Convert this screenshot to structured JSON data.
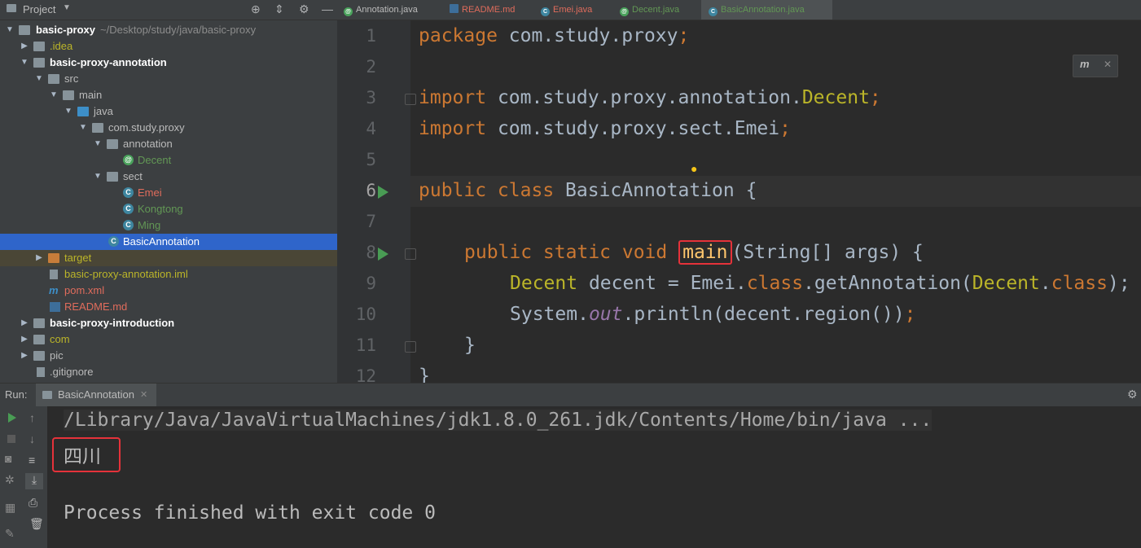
{
  "project_panel": {
    "title": "Project",
    "tree": [
      {
        "label": "basic-proxy",
        "path": "~/Desktop/study/java/basic-proxy"
      },
      {
        "label": ".idea"
      },
      {
        "label": "basic-proxy-annotation"
      },
      {
        "label": "src"
      },
      {
        "label": "main"
      },
      {
        "label": "java"
      },
      {
        "label": "com.study.proxy"
      },
      {
        "label": "annotation"
      },
      {
        "label": "Decent"
      },
      {
        "label": "sect"
      },
      {
        "label": "Emei"
      },
      {
        "label": "Kongtong"
      },
      {
        "label": "Ming"
      },
      {
        "label": "BasicAnnotation"
      },
      {
        "label": "target"
      },
      {
        "label": "basic-proxy-annotation.iml"
      },
      {
        "label": "pom.xml"
      },
      {
        "label": "README.md"
      },
      {
        "label": "basic-proxy-introduction"
      },
      {
        "label": "com"
      },
      {
        "label": "pic"
      },
      {
        "label": ".gitignore"
      }
    ]
  },
  "tabs": [
    {
      "label": "Annotation.java"
    },
    {
      "label": "README.md"
    },
    {
      "label": "Emei.java"
    },
    {
      "label": "Decent.java"
    },
    {
      "label": "BasicAnnotation.java"
    }
  ],
  "editor": {
    "line_numbers": [
      "1",
      "2",
      "3",
      "4",
      "5",
      "6",
      "7",
      "8",
      "9",
      "10",
      "11",
      "12"
    ],
    "code": {
      "l1_kw": "package",
      "l1_rest": " com.study.proxy",
      "l1_semi": ";",
      "l3_kw": "import",
      "l3_rest": " com.study.proxy.annotation.",
      "l3_ann": "Decent",
      "l3_semi": ";",
      "l4_kw": "import",
      "l4_rest": " com.study.proxy.sect.Emei",
      "l4_semi": ";",
      "l6_kw": "public class",
      "l6_rest": " BasicAnnotation {",
      "l8_kw": "public static void",
      "l8_main": "main",
      "l8_rest": "(String[] args) {",
      "l9_ann": "Decent",
      "l9_a": " decent = Emei.",
      "l9_kw": "class",
      "l9_b": ".getAnnotation(",
      "l9_ann2": "Decent",
      "l9_c": ".",
      "l9_kw2": "class",
      "l9_d": ");",
      "l10_a": "System.",
      "l10_out": "out",
      "l10_b": ".println(decent.region())",
      "l10_semi": ";",
      "l11": "}",
      "l12": "}"
    }
  },
  "run_panel": {
    "label": "Run:",
    "tab_label": "BasicAnnotation",
    "command": "/Library/Java/JavaVirtualMachines/jdk1.8.0_261.jdk/Contents/Home/bin/java ...",
    "output": "四川",
    "exit_message": "Process finished with exit code 0"
  },
  "colors": {
    "selection": "#2f65ca",
    "highlight_box": "#e5323a",
    "keyword": "#cc7832",
    "annotation": "#bbb529",
    "run_green": "#499c54"
  }
}
